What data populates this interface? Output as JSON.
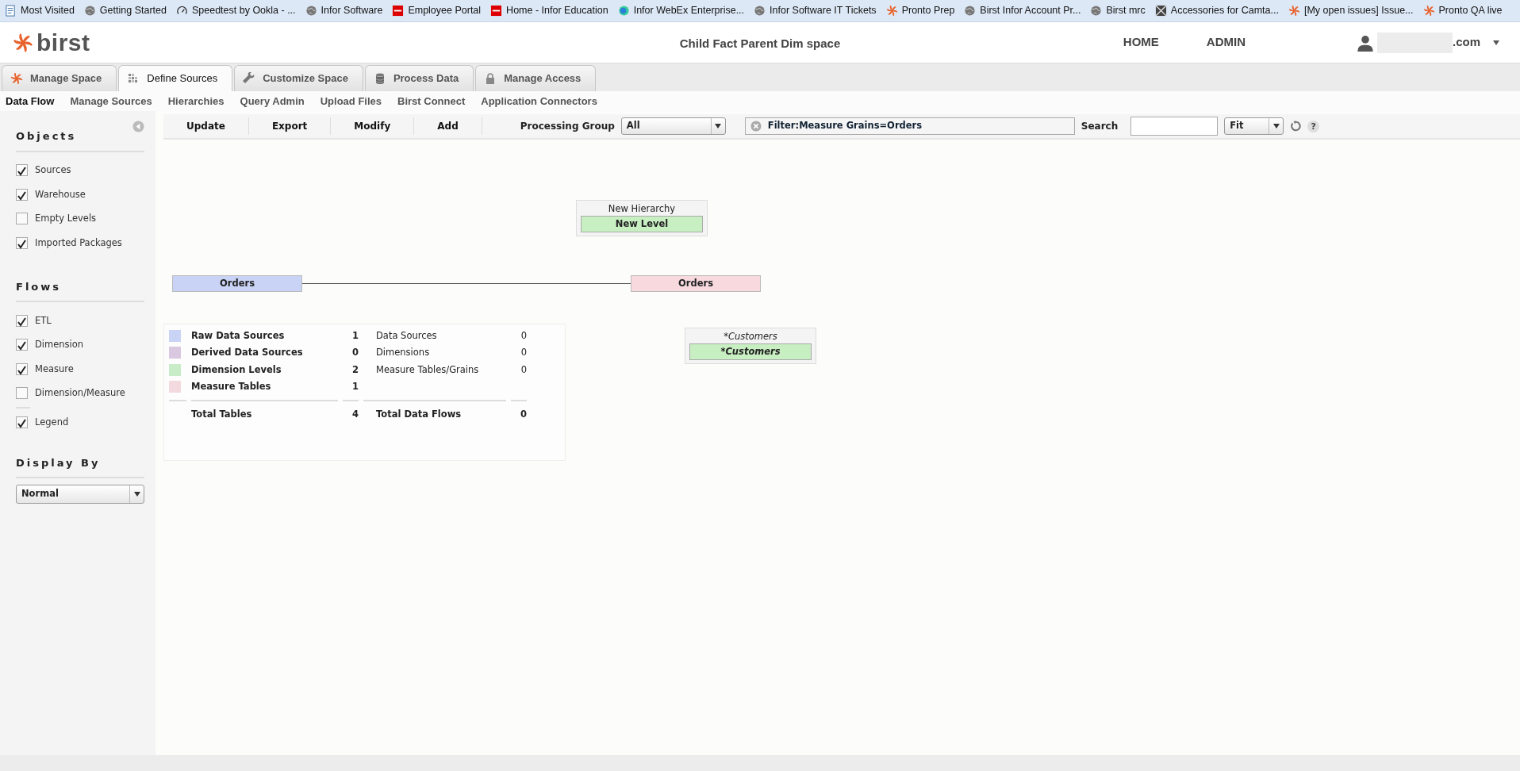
{
  "bookmarks": [
    {
      "label": "Most Visited",
      "kind": "page"
    },
    {
      "label": "Getting Started",
      "kind": "globe"
    },
    {
      "label": "Speedtest by Ookla - ...",
      "kind": "gauge"
    },
    {
      "label": "Infor Software",
      "kind": "globe"
    },
    {
      "label": "Employee Portal",
      "kind": "infor"
    },
    {
      "label": "Home - Infor Education",
      "kind": "infor"
    },
    {
      "label": "Infor WebEx Enterprise...",
      "kind": "ball"
    },
    {
      "label": "Infor Software IT Tickets",
      "kind": "globe"
    },
    {
      "label": "Pronto Prep",
      "kind": "pinwheel"
    },
    {
      "label": "Birst Infor Account Pr...",
      "kind": "globe"
    },
    {
      "label": "Birst mrc",
      "kind": "globe"
    },
    {
      "label": "Accessories for Camta...",
      "kind": "cross"
    },
    {
      "label": "[My open issues] Issue...",
      "kind": "pinwheel"
    },
    {
      "label": "Pronto QA live",
      "kind": "pinwheel"
    }
  ],
  "header": {
    "logo": "birst",
    "space_title": "Child Fact Parent Dim space",
    "nav": [
      "HOME",
      "ADMIN"
    ],
    "user_suffix": ".com"
  },
  "tabs": [
    {
      "label": "Manage Space",
      "kind": "pinwheel",
      "selected": false
    },
    {
      "label": "Define Sources",
      "kind": "grid",
      "selected": true
    },
    {
      "label": "Customize Space",
      "kind": "wrench",
      "selected": false
    },
    {
      "label": "Process Data",
      "kind": "database",
      "selected": false
    },
    {
      "label": "Manage Access",
      "kind": "lock",
      "selected": false
    }
  ],
  "subnav": [
    {
      "label": "Data Flow",
      "selected": true
    },
    {
      "label": "Manage Sources",
      "selected": false
    },
    {
      "label": "Hierarchies",
      "selected": false
    },
    {
      "label": "Query Admin",
      "selected": false
    },
    {
      "label": "Upload Files",
      "selected": false
    },
    {
      "label": "Birst Connect",
      "selected": false
    },
    {
      "label": "Application Connectors",
      "selected": false
    }
  ],
  "sidebar": {
    "sections": [
      {
        "title": "Objects",
        "items": [
          {
            "label": "Sources",
            "checked": true
          },
          {
            "label": "Warehouse",
            "checked": true
          },
          {
            "label": "Empty Levels",
            "checked": false
          },
          {
            "label": "Imported Packages",
            "checked": true
          }
        ]
      },
      {
        "title": "Flows",
        "items": [
          {
            "label": "ETL",
            "checked": true
          },
          {
            "label": "Dimension",
            "checked": true
          },
          {
            "label": "Measure",
            "checked": true
          },
          {
            "label": "Dimension/Measure",
            "checked": false
          }
        ],
        "extra": [
          {
            "label": "Legend",
            "checked": true
          }
        ]
      }
    ],
    "display_by": {
      "title": "Display By",
      "value": "Normal"
    }
  },
  "toolbar": {
    "buttons": [
      "Update",
      "Export",
      "Modify",
      "Add"
    ],
    "processing_group_label": "Processing Group",
    "processing_group_value": "All",
    "filter": "**Filter:**Measure Grains=Orders",
    "search_label": "Search",
    "zoom_value": "Fit",
    "help": "?"
  },
  "diagram": {
    "hierarchies": [
      {
        "title": "New Hierarchy",
        "level": "New Level",
        "imported": false
      },
      {
        "title": "*Customers",
        "level": "*Customers",
        "imported": true
      }
    ],
    "source_table": {
      "label": "Orders",
      "color": "#c9d3f5"
    },
    "measure_table": {
      "label": "Orders",
      "color": "#f7d9de"
    },
    "legend": {
      "tables": [
        {
          "label": "Raw Data Sources",
          "count": "1",
          "color": "#c9d3f5"
        },
        {
          "label": "Derived Data Sources",
          "count": "0",
          "color": "#d9c8e0"
        },
        {
          "label": "Dimension Levels",
          "count": "2",
          "color": "#c8ecc8"
        },
        {
          "label": "Measure Tables",
          "count": "1",
          "color": "#f2dade"
        }
      ],
      "flows": [
        {
          "label": "Data Sources",
          "count": "0"
        },
        {
          "label": "Dimensions",
          "count": "0"
        },
        {
          "label": "Measure Tables/Grains",
          "count": "0"
        }
      ],
      "total_tables_label": "Total Tables",
      "total_tables": "4",
      "total_flows_label": "Total Data Flows",
      "total_flows": "0"
    }
  }
}
